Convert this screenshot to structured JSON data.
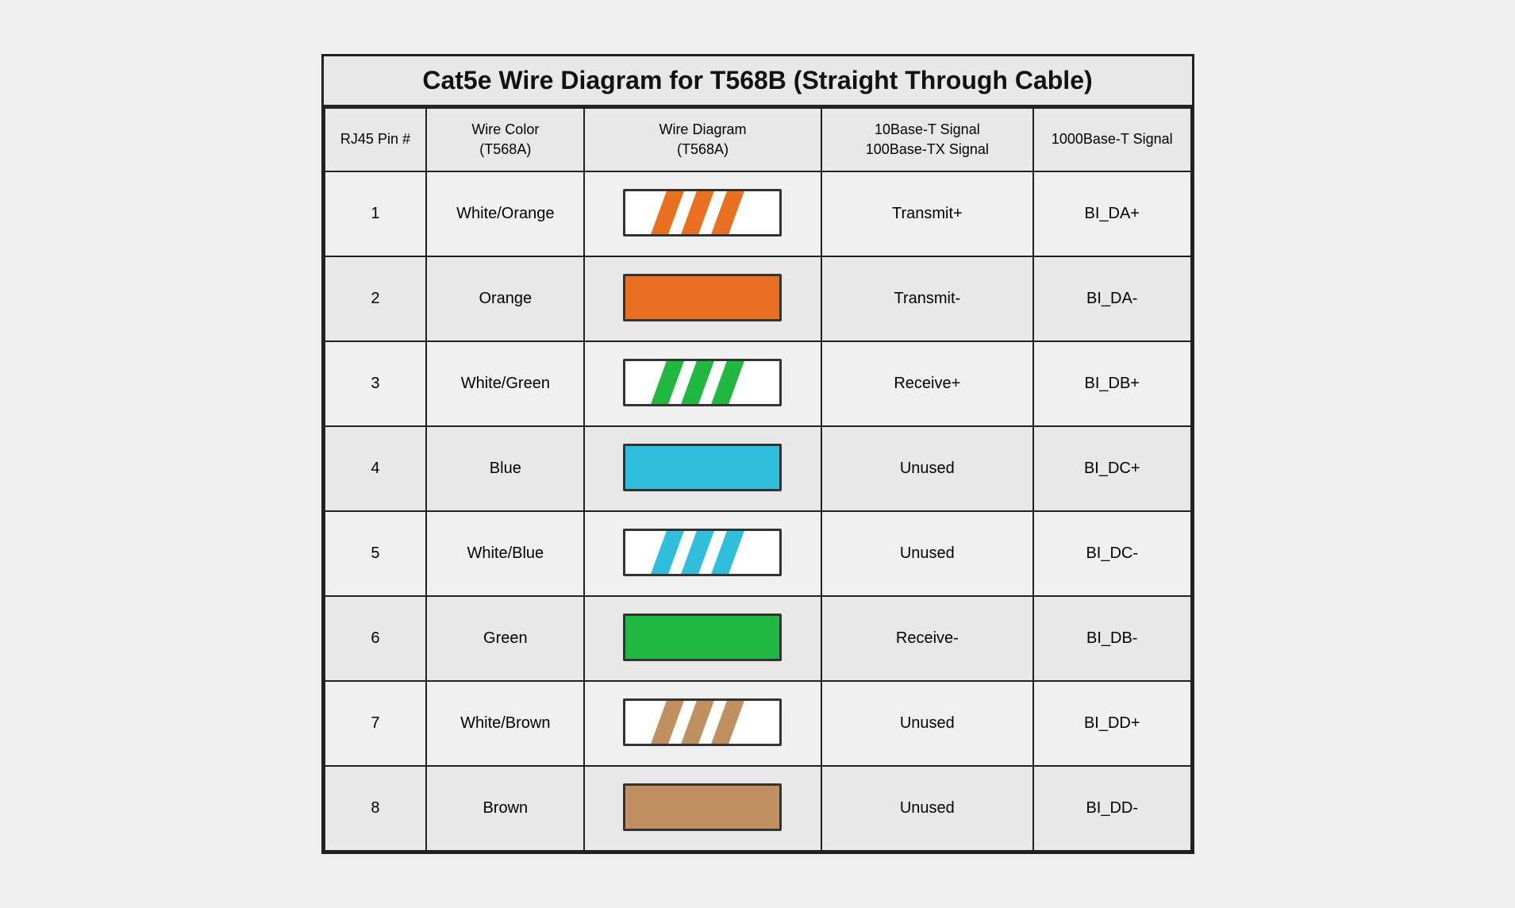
{
  "title": "Cat5e Wire Diagram for T568B (Straight Through Cable)",
  "headers": {
    "pin": "RJ45 Pin #",
    "wire_color": "Wire Color\n(T568A)",
    "wire_diagram": "Wire Diagram\n(T568A)",
    "signal_10_100": "10Base-T Signal\n100Base-TX Signal",
    "signal_1000": "1000Base-T Signal"
  },
  "rows": [
    {
      "pin": "1",
      "color_name": "White/Orange",
      "wire_type": "stripe",
      "wire_color": "#E87020",
      "signal": "Transmit+",
      "gbase": "BI_DA+"
    },
    {
      "pin": "2",
      "color_name": "Orange",
      "wire_type": "solid",
      "wire_color": "#E87020",
      "signal": "Transmit-",
      "gbase": "BI_DA-"
    },
    {
      "pin": "3",
      "color_name": "White/Green",
      "wire_type": "stripe",
      "wire_color": "#20B840",
      "signal": "Receive+",
      "gbase": "BI_DB+"
    },
    {
      "pin": "4",
      "color_name": "Blue",
      "wire_type": "solid",
      "wire_color": "#30BEDD",
      "signal": "Unused",
      "gbase": "BI_DC+"
    },
    {
      "pin": "5",
      "color_name": "White/Blue",
      "wire_type": "stripe",
      "wire_color": "#30BEDD",
      "signal": "Unused",
      "gbase": "BI_DC-"
    },
    {
      "pin": "6",
      "color_name": "Green",
      "wire_type": "solid",
      "wire_color": "#20B840",
      "signal": "Receive-",
      "gbase": "BI_DB-"
    },
    {
      "pin": "7",
      "color_name": "White/Brown",
      "wire_type": "stripe",
      "wire_color": "#C09060",
      "signal": "Unused",
      "gbase": "BI_DD+"
    },
    {
      "pin": "8",
      "color_name": "Brown",
      "wire_type": "solid",
      "wire_color": "#C09060",
      "signal": "Unused",
      "gbase": "BI_DD-"
    }
  ]
}
